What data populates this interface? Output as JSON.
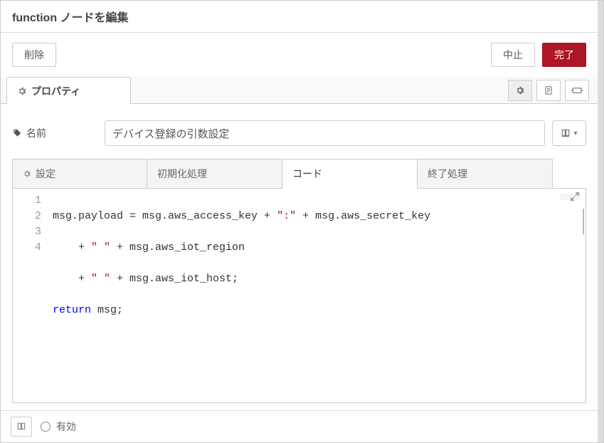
{
  "header": {
    "title": "function ノードを編集"
  },
  "actions": {
    "delete_label": "削除",
    "cancel_label": "中止",
    "done_label": "完了"
  },
  "outer_tabs": {
    "properties_label": "プロパティ"
  },
  "form": {
    "name_label": "名前",
    "name_value": "デバイス登録の引数設定"
  },
  "inner_tabs": {
    "setup_label": "設定",
    "init_label": "初期化処理",
    "code_label": "コード",
    "close_label": "終了処理"
  },
  "code": {
    "line_numbers": [
      "1",
      "2",
      "3",
      "4"
    ],
    "l1_a": "msg.payload = msg.aws_access_key + ",
    "l1_s": "\":\"",
    "l1_b": " + msg.aws_secret_key",
    "l2_a": "    + ",
    "l2_s": "\" \"",
    "l2_b": " + msg.aws_iot_region",
    "l3_a": "    + ",
    "l3_s": "\" \"",
    "l3_b": " + msg.aws_iot_host;",
    "l4_kw": "return",
    "l4_b": " msg;"
  },
  "footer": {
    "enabled_label": "有効"
  }
}
